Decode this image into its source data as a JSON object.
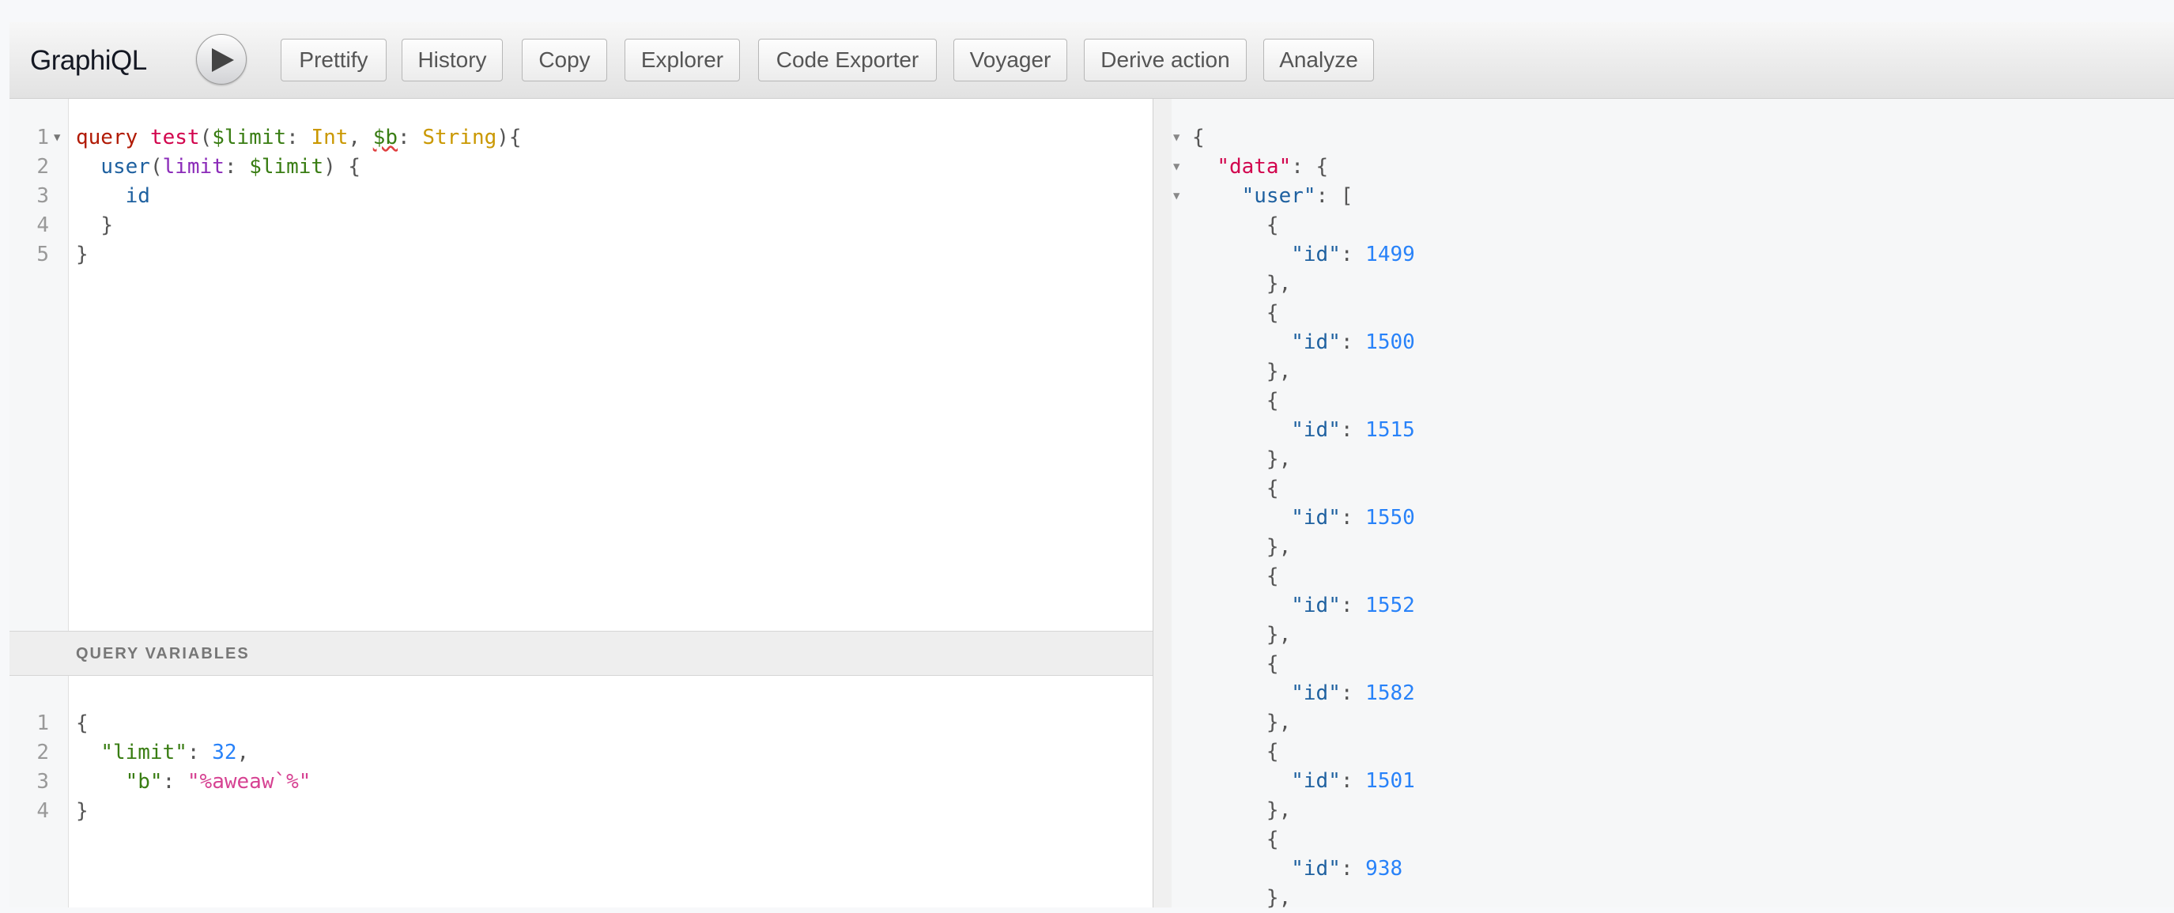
{
  "app": {
    "title": "GraphiQL"
  },
  "toolbar": {
    "execute_label": "",
    "buttons": [
      {
        "label": "Prettify"
      },
      {
        "label": "History"
      },
      {
        "label": "Copy"
      },
      {
        "label": "Explorer"
      },
      {
        "label": "Code Exporter"
      },
      {
        "label": "Voyager"
      },
      {
        "label": "Derive action"
      },
      {
        "label": "Analyze"
      }
    ]
  },
  "query_editor": {
    "line_numbers": [
      "1",
      "2",
      "3",
      "4",
      "5"
    ],
    "lines": [
      [
        "query",
        " ",
        "test",
        "(",
        "$limit",
        ": ",
        "Int",
        ", ",
        "$b",
        ": ",
        "String",
        "){"
      ],
      [
        "  ",
        "user",
        "(",
        "limit",
        ": ",
        "$limit",
        ") {"
      ],
      [
        "    ",
        "id"
      ],
      [
        "  ",
        "}"
      ],
      [
        "}"
      ]
    ]
  },
  "variables": {
    "title": "QUERY VARIABLES",
    "line_numbers": [
      "1",
      "2",
      "3",
      "4"
    ],
    "lines": [
      [
        "{"
      ],
      [
        "  ",
        "\"limit\"",
        ": ",
        "32",
        ","
      ],
      [
        "    ",
        "\"b\"",
        ": ",
        "\"%aweaw`%\""
      ],
      [
        "}"
      ]
    ]
  },
  "result": {
    "header_lines": [
      [
        "{"
      ],
      [
        "  ",
        "\"data\"",
        ": {"
      ],
      [
        "    ",
        "\"user\"",
        ": ["
      ]
    ],
    "ids": [
      "1499",
      "1500",
      "1515",
      "1550",
      "1552",
      "1582",
      "1501",
      "938"
    ]
  }
}
